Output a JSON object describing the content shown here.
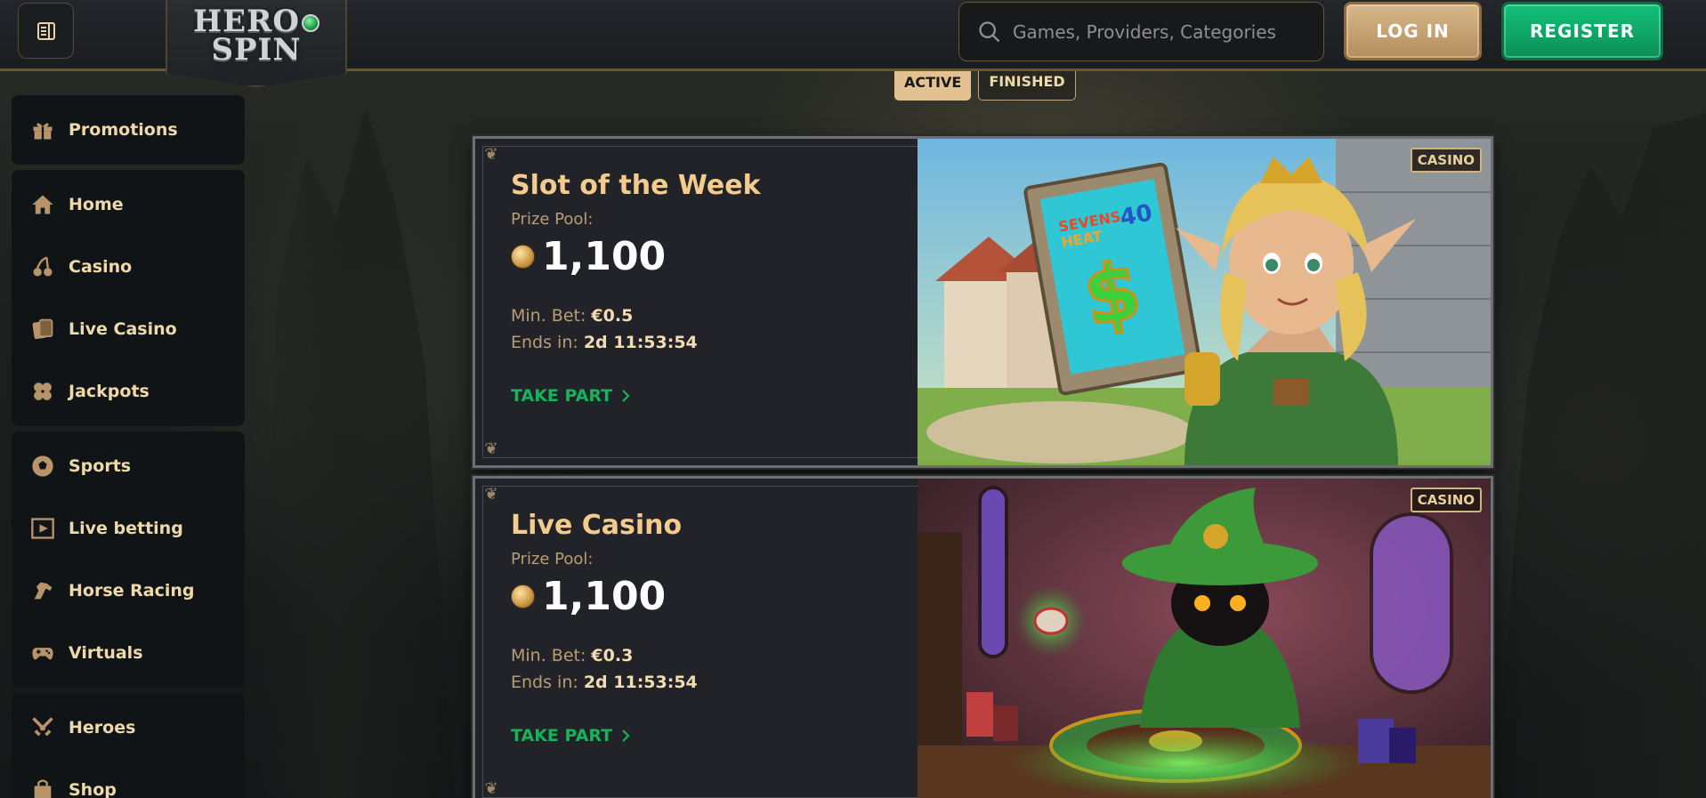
{
  "header": {
    "logo_line1": "HERO",
    "logo_line2": "SPIN",
    "search_placeholder": "Games, Providers, Categories",
    "login_label": "LOG IN",
    "register_label": "REGISTER"
  },
  "sidebar": {
    "groups": [
      [
        {
          "label": "Promotions",
          "icon": "gift-icon"
        }
      ],
      [
        {
          "label": "Home",
          "icon": "home-icon"
        },
        {
          "label": "Casino",
          "icon": "cherries-icon"
        },
        {
          "label": "Live Casino",
          "icon": "cards-icon"
        },
        {
          "label": "Jackpots",
          "icon": "clover-icon"
        }
      ],
      [
        {
          "label": "Sports",
          "icon": "soccer-ball-icon"
        },
        {
          "label": "Live betting",
          "icon": "play-square-icon"
        },
        {
          "label": "Horse Racing",
          "icon": "horse-icon"
        },
        {
          "label": "Virtuals",
          "icon": "gamepad-icon"
        }
      ],
      [
        {
          "label": "Heroes",
          "icon": "swords-icon"
        },
        {
          "label": "Shop",
          "icon": "shopping-bag-icon"
        }
      ]
    ]
  },
  "tabs": {
    "active": "ACTIVE",
    "finished": "FINISHED"
  },
  "tournaments": [
    {
      "title": "Slot of the Week",
      "prize_label": "Prize Pool:",
      "prize_value": "1,100",
      "min_bet_label": "Min. Bet:",
      "min_bet_value": "€0.5",
      "ends_label": "Ends in:",
      "ends_value": "2d 11:53:54",
      "cta": "TAKE PART",
      "badge": "CASINO",
      "image_art_text": "SEVENS HEAT 40"
    },
    {
      "title": "Live Casino",
      "prize_label": "Prize Pool:",
      "prize_value": "1,100",
      "min_bet_label": "Min. Bet:",
      "min_bet_value": "€0.3",
      "ends_label": "Ends in:",
      "ends_value": "2d 11:53:54",
      "cta": "TAKE PART",
      "badge": "CASINO"
    }
  ],
  "colors": {
    "accent_gold": "#f3cc8d",
    "cta_green": "#16b35b",
    "register_green": "#0fa866",
    "login_tan": "#c9a473"
  }
}
